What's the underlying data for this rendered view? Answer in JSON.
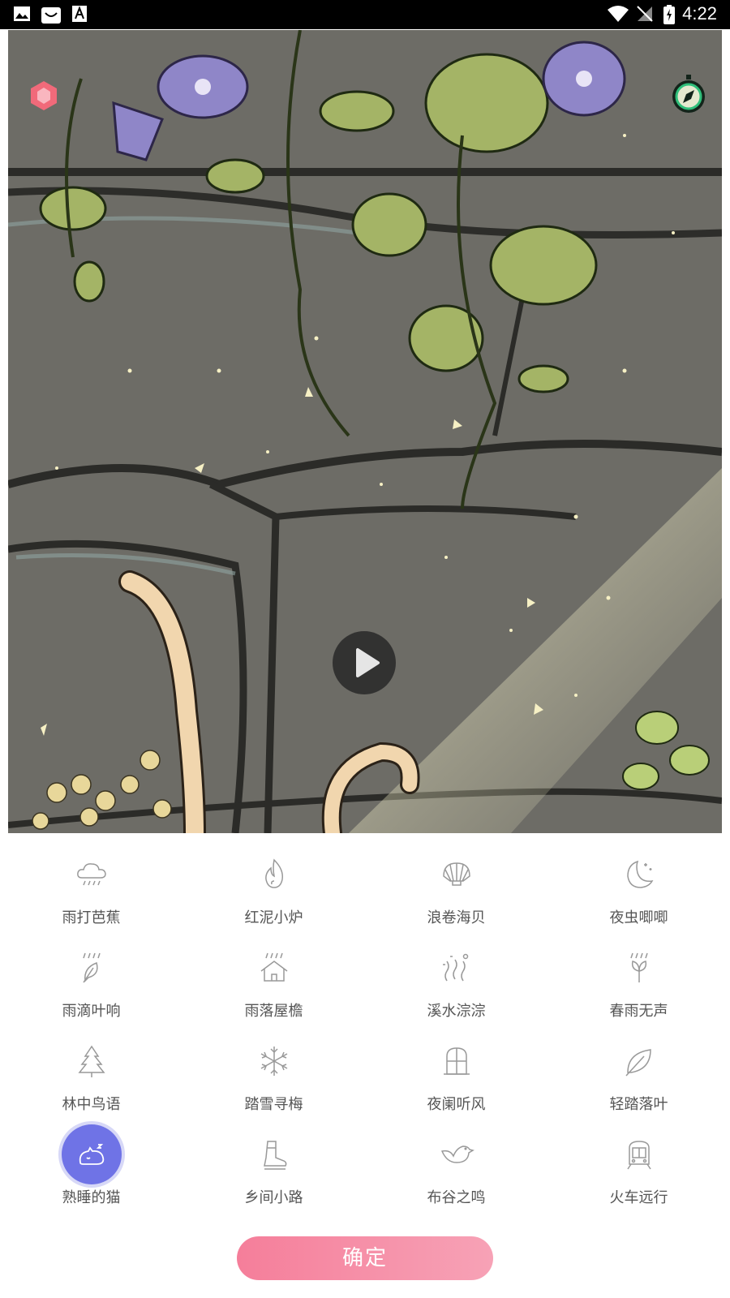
{
  "status_bar": {
    "time": "4:22",
    "left_icons": [
      "image-icon",
      "app-store-icon",
      "font-icon"
    ],
    "right_icons": [
      "wifi-icon",
      "no-signal-icon",
      "battery-charging-icon"
    ]
  },
  "player": {
    "play_icon": "play-icon",
    "top_left_icon": "hexagon-icon",
    "top_right_icon": "compass-icon"
  },
  "sounds": [
    {
      "label": "雨打芭蕉",
      "icon": "rain-cloud-icon",
      "active": false
    },
    {
      "label": "红泥小炉",
      "icon": "flame-icon",
      "active": false
    },
    {
      "label": "浪卷海贝",
      "icon": "seashell-icon",
      "active": false
    },
    {
      "label": "夜虫唧唧",
      "icon": "moon-stars-icon",
      "active": false
    },
    {
      "label": "雨滴叶响",
      "icon": "rain-leaf-icon",
      "active": false
    },
    {
      "label": "雨落屋檐",
      "icon": "rain-house-icon",
      "active": false
    },
    {
      "label": "溪水淙淙",
      "icon": "stream-icon",
      "active": false
    },
    {
      "label": "春雨无声",
      "icon": "rain-sprout-icon",
      "active": false
    },
    {
      "label": "林中鸟语",
      "icon": "pine-tree-icon",
      "active": false
    },
    {
      "label": "踏雪寻梅",
      "icon": "snowflake-icon",
      "active": false
    },
    {
      "label": "夜阑听风",
      "icon": "window-icon",
      "active": false
    },
    {
      "label": "轻踏落叶",
      "icon": "leaf-icon",
      "active": false
    },
    {
      "label": "熟睡的猫",
      "icon": "sleeping-cat-icon",
      "active": true
    },
    {
      "label": "乡间小路",
      "icon": "boot-icon",
      "active": false
    },
    {
      "label": "布谷之鸣",
      "icon": "bird-icon",
      "active": false
    },
    {
      "label": "火车远行",
      "icon": "train-icon",
      "active": false
    }
  ],
  "confirm_label": "确定",
  "colors": {
    "accent_active": "#6f73e6",
    "confirm_start": "#f57e9a",
    "confirm_end": "#f7a2b6"
  }
}
